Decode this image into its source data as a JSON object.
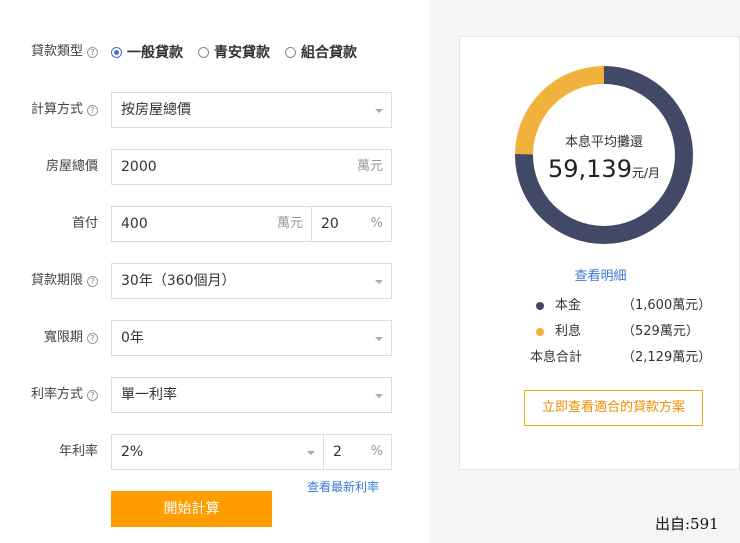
{
  "form": {
    "loan_type": {
      "label": "貸款類型",
      "options": [
        "一般貸款",
        "青安貸款",
        "組合貸款"
      ],
      "selected": "一般貸款"
    },
    "calc_method": {
      "label": "計算方式",
      "value": "按房屋總價"
    },
    "house_price": {
      "label": "房屋總價",
      "value": "2000",
      "unit": "萬元"
    },
    "down_payment": {
      "label": "首付",
      "amount": "400",
      "amount_unit": "萬元",
      "percent": "20",
      "percent_unit": "%"
    },
    "loan_term": {
      "label": "貸款期限",
      "value": "30年（360個月）"
    },
    "grace_period": {
      "label": "寬限期",
      "value": "0年"
    },
    "rate_mode": {
      "label": "利率方式",
      "value": "單一利率"
    },
    "annual_rate": {
      "label": "年利率",
      "value": "2%",
      "number": "2",
      "unit": "%"
    },
    "latest_rate_link": "查看最新利率",
    "calc_button": "開始計算"
  },
  "result": {
    "donut_caption": "本息平均攤還",
    "monthly_amount": "59,139",
    "monthly_unit": "元/月",
    "detail_link": "查看明細",
    "principal": {
      "label": "本金",
      "value": "（1,600萬元）",
      "color": "#414966"
    },
    "interest": {
      "label": "利息",
      "value": "（529萬元）",
      "color": "#f0b23c"
    },
    "total": {
      "label": "本息合計",
      "value": "（2,129萬元）"
    },
    "plan_button": "立即查看適合的貸款方案"
  },
  "source_label": "出自:591",
  "chart_data": {
    "type": "pie",
    "categories": [
      "本金",
      "利息"
    ],
    "values": [
      1600,
      529
    ],
    "title": "本息平均攤還"
  }
}
